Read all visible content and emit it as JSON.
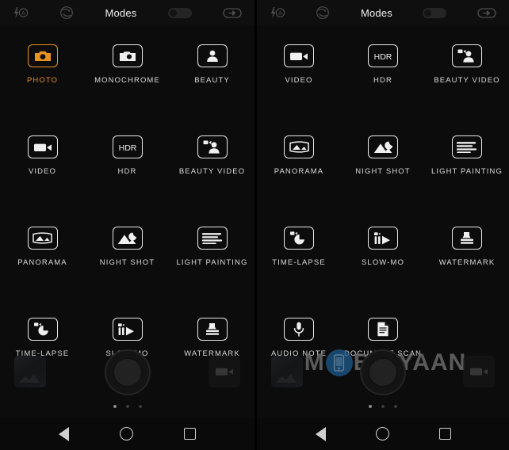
{
  "topbar": {
    "title": "Modes",
    "icons": {
      "flash_auto": "flash-auto-icon",
      "shutter_mode": "aperture-icon",
      "toggle": "hdr-toggle",
      "settings": "link-settings-icon"
    }
  },
  "left_panel": {
    "rows": [
      [
        {
          "label": "PHOTO",
          "icon": "photo-camera-icon",
          "selected": true
        },
        {
          "label": "MONOCHROME",
          "icon": "photo-camera-icon",
          "selected": false
        },
        {
          "label": "BEAUTY",
          "icon": "beauty-portrait-icon",
          "selected": false
        }
      ],
      [
        {
          "label": "VIDEO",
          "icon": "video-camera-icon",
          "selected": false
        },
        {
          "label": "HDR",
          "icon": "hdr-text-icon",
          "selected": false
        },
        {
          "label": "BEAUTY VIDEO",
          "icon": "beauty-video-icon",
          "selected": false
        }
      ],
      [
        {
          "label": "PANORAMA",
          "icon": "panorama-icon",
          "selected": false
        },
        {
          "label": "NIGHT SHOT",
          "icon": "night-shot-icon",
          "selected": false
        },
        {
          "label": "LIGHT PAINTING",
          "icon": "light-painting-icon",
          "selected": false
        }
      ],
      [
        {
          "label": "TIME-LAPSE",
          "icon": "time-lapse-icon",
          "selected": false
        },
        {
          "label": "SLOW-MO",
          "icon": "slow-mo-icon",
          "selected": false
        },
        {
          "label": "WATERMARK",
          "icon": "watermark-stamp-icon",
          "selected": false
        }
      ]
    ]
  },
  "right_panel": {
    "rows": [
      [
        {
          "label": "VIDEO",
          "icon": "video-camera-icon",
          "selected": false
        },
        {
          "label": "HDR",
          "icon": "hdr-text-icon",
          "selected": false
        },
        {
          "label": "BEAUTY VIDEO",
          "icon": "beauty-video-icon",
          "selected": false
        }
      ],
      [
        {
          "label": "PANORAMA",
          "icon": "panorama-icon",
          "selected": false
        },
        {
          "label": "NIGHT SHOT",
          "icon": "night-shot-icon",
          "selected": false
        },
        {
          "label": "LIGHT PAINTING",
          "icon": "light-painting-icon",
          "selected": false
        }
      ],
      [
        {
          "label": "TIME-LAPSE",
          "icon": "time-lapse-icon",
          "selected": false
        },
        {
          "label": "SLOW-MO",
          "icon": "slow-mo-icon",
          "selected": false
        },
        {
          "label": "WATERMARK",
          "icon": "watermark-stamp-icon",
          "selected": false
        }
      ],
      [
        {
          "label": "AUDIO NOTE",
          "icon": "microphone-icon",
          "selected": false
        },
        {
          "label": "DOCUMENT SCAN",
          "icon": "document-icon",
          "selected": false
        },
        {
          "label": "",
          "icon": "",
          "selected": false
        }
      ]
    ]
  },
  "camera_controls": {
    "gallery_thumb": "gallery-thumbnail",
    "shutter": "shutter-button",
    "video_toggle": "video-record-button",
    "page_dots": {
      "count": 3,
      "active_index": 0
    }
  },
  "navbar": {
    "back": "back-button",
    "home": "home-button",
    "recents": "recents-button"
  },
  "watermark": {
    "text_before": "M",
    "text_after": "BIGYAAN",
    "logo": "mobigyaan-phone-logo"
  },
  "colors": {
    "accent": "#e8931f",
    "icon": "#e8e8e8",
    "label": "#dcdcdc",
    "background": "#0c0c0c",
    "watermark_blue": "#1d5b8f"
  }
}
